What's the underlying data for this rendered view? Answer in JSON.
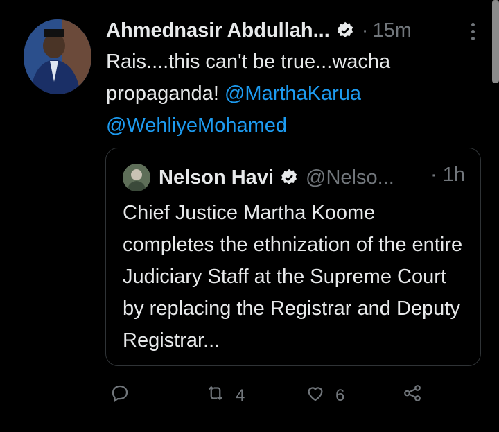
{
  "tweet": {
    "author_name": "Ahmednasir Abdullah...",
    "separator": "·",
    "time": "15m",
    "text_plain": "Rais....this can't be true...wacha propaganda!",
    "mention_1": "@MarthaKarua",
    "mention_2": "@WehliyeMohamed"
  },
  "quoted": {
    "author_name": "Nelson Havi",
    "handle": "@Nelso...",
    "separator": "·",
    "time": "1h",
    "text": "Chief Justice Martha Koome completes the ethnization of the entire Judiciary Staff at the Supreme Court by replacing the Registrar and Deputy Registrar..."
  },
  "actions": {
    "retweet_count": "4",
    "like_count": "6"
  },
  "icons": [
    "verified-badge-icon",
    "more-icon",
    "reply-icon",
    "retweet-icon",
    "like-icon",
    "share-icon"
  ],
  "colors": {
    "background": "#000000",
    "text": "#e7e9ea",
    "muted": "#71767b",
    "accent": "#1d9bf0"
  }
}
